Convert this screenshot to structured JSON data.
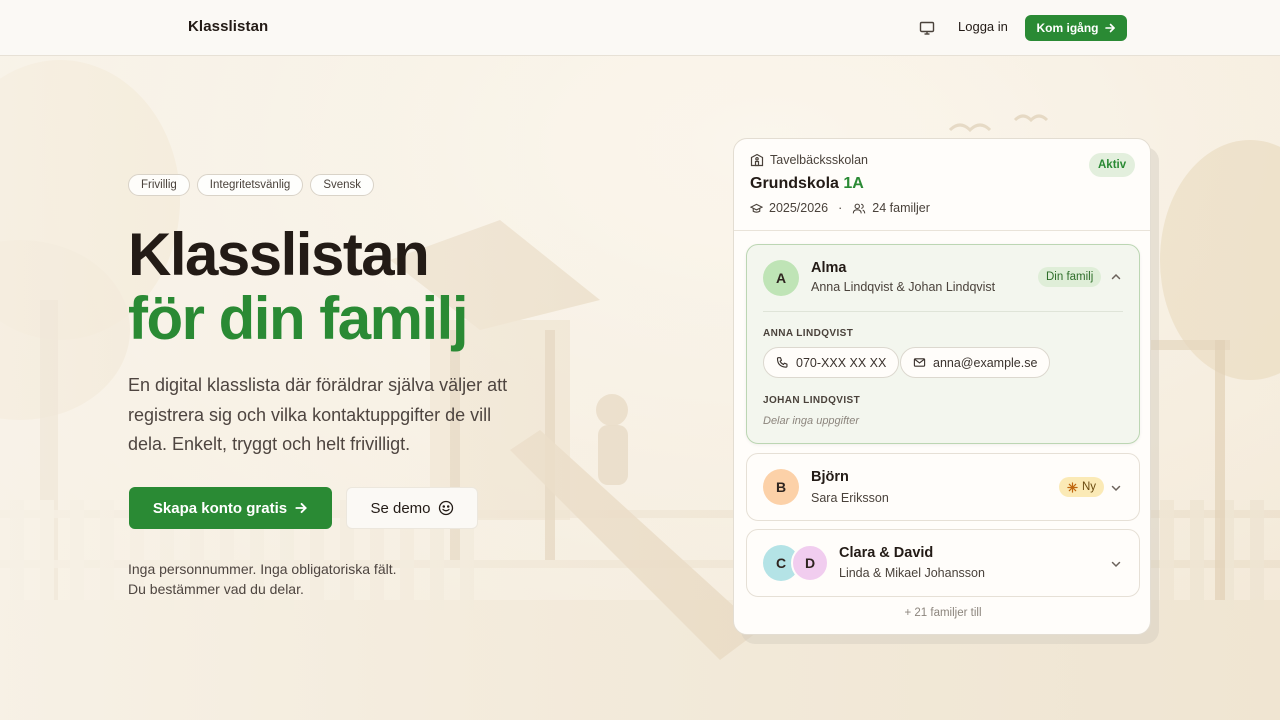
{
  "header": {
    "brand": "Klasslistan",
    "monitor_icon": "monitor-icon",
    "login_label": "Logga in",
    "cta_label": "Kom igång",
    "cta_icon": "arrow-right-icon"
  },
  "hero": {
    "chips": [
      "Frivillig",
      "Integritetsvänlig",
      "Svensk"
    ],
    "title_line1": "Klasslistan",
    "title_line2": "för din familj",
    "lead": "En digital klasslista där föräldrar själva väljer att registrera sig och vilka kontaktuppgifter de vill dela. Enkelt, tryggt och helt frivilligt.",
    "primary_button": "Skapa konto gratis",
    "secondary_button": "Se demo",
    "fine_print_line1": "Inga personnummer. Inga obligatoriska fält.",
    "fine_print_line2": "Du bestämmer vad du delar."
  },
  "card": {
    "school": "Tavelbäcksskolan",
    "title_prefix": "Grundskola",
    "class_name": "1A",
    "status": "Aktiv",
    "year": "2025/2026",
    "separator": "·",
    "families_count": "24 familjer",
    "families": [
      {
        "initial": "A",
        "name": "Alma",
        "parents": "Anna Lindqvist & Johan Lindqvist",
        "badge": "Din familj",
        "expanded": true,
        "contacts": [
          {
            "label": "ANNA LINDQVIST",
            "phone": "070-XXX XX XX",
            "email": "anna@example.se"
          },
          {
            "label": "JOHAN LINDQVIST",
            "note": "Delar inga uppgifter"
          }
        ]
      },
      {
        "initial": "B",
        "name": "Björn",
        "parents": "Sara Eriksson",
        "badge": "Ny",
        "expanded": false
      },
      {
        "initials": [
          "C",
          "D"
        ],
        "name": "Clara & David",
        "parents": "Linda & Mikael Johansson",
        "expanded": false
      }
    ],
    "more": "+ 21 familjer till"
  },
  "colors": {
    "brand_green": "#2a8a34",
    "text_dark": "#231b16",
    "avatar_a": "#bfe4b6",
    "avatar_b": "#fcd1a8",
    "avatar_c": "#b4e3e6",
    "avatar_d": "#f1cdef",
    "badge_new": "#fbeab6"
  }
}
